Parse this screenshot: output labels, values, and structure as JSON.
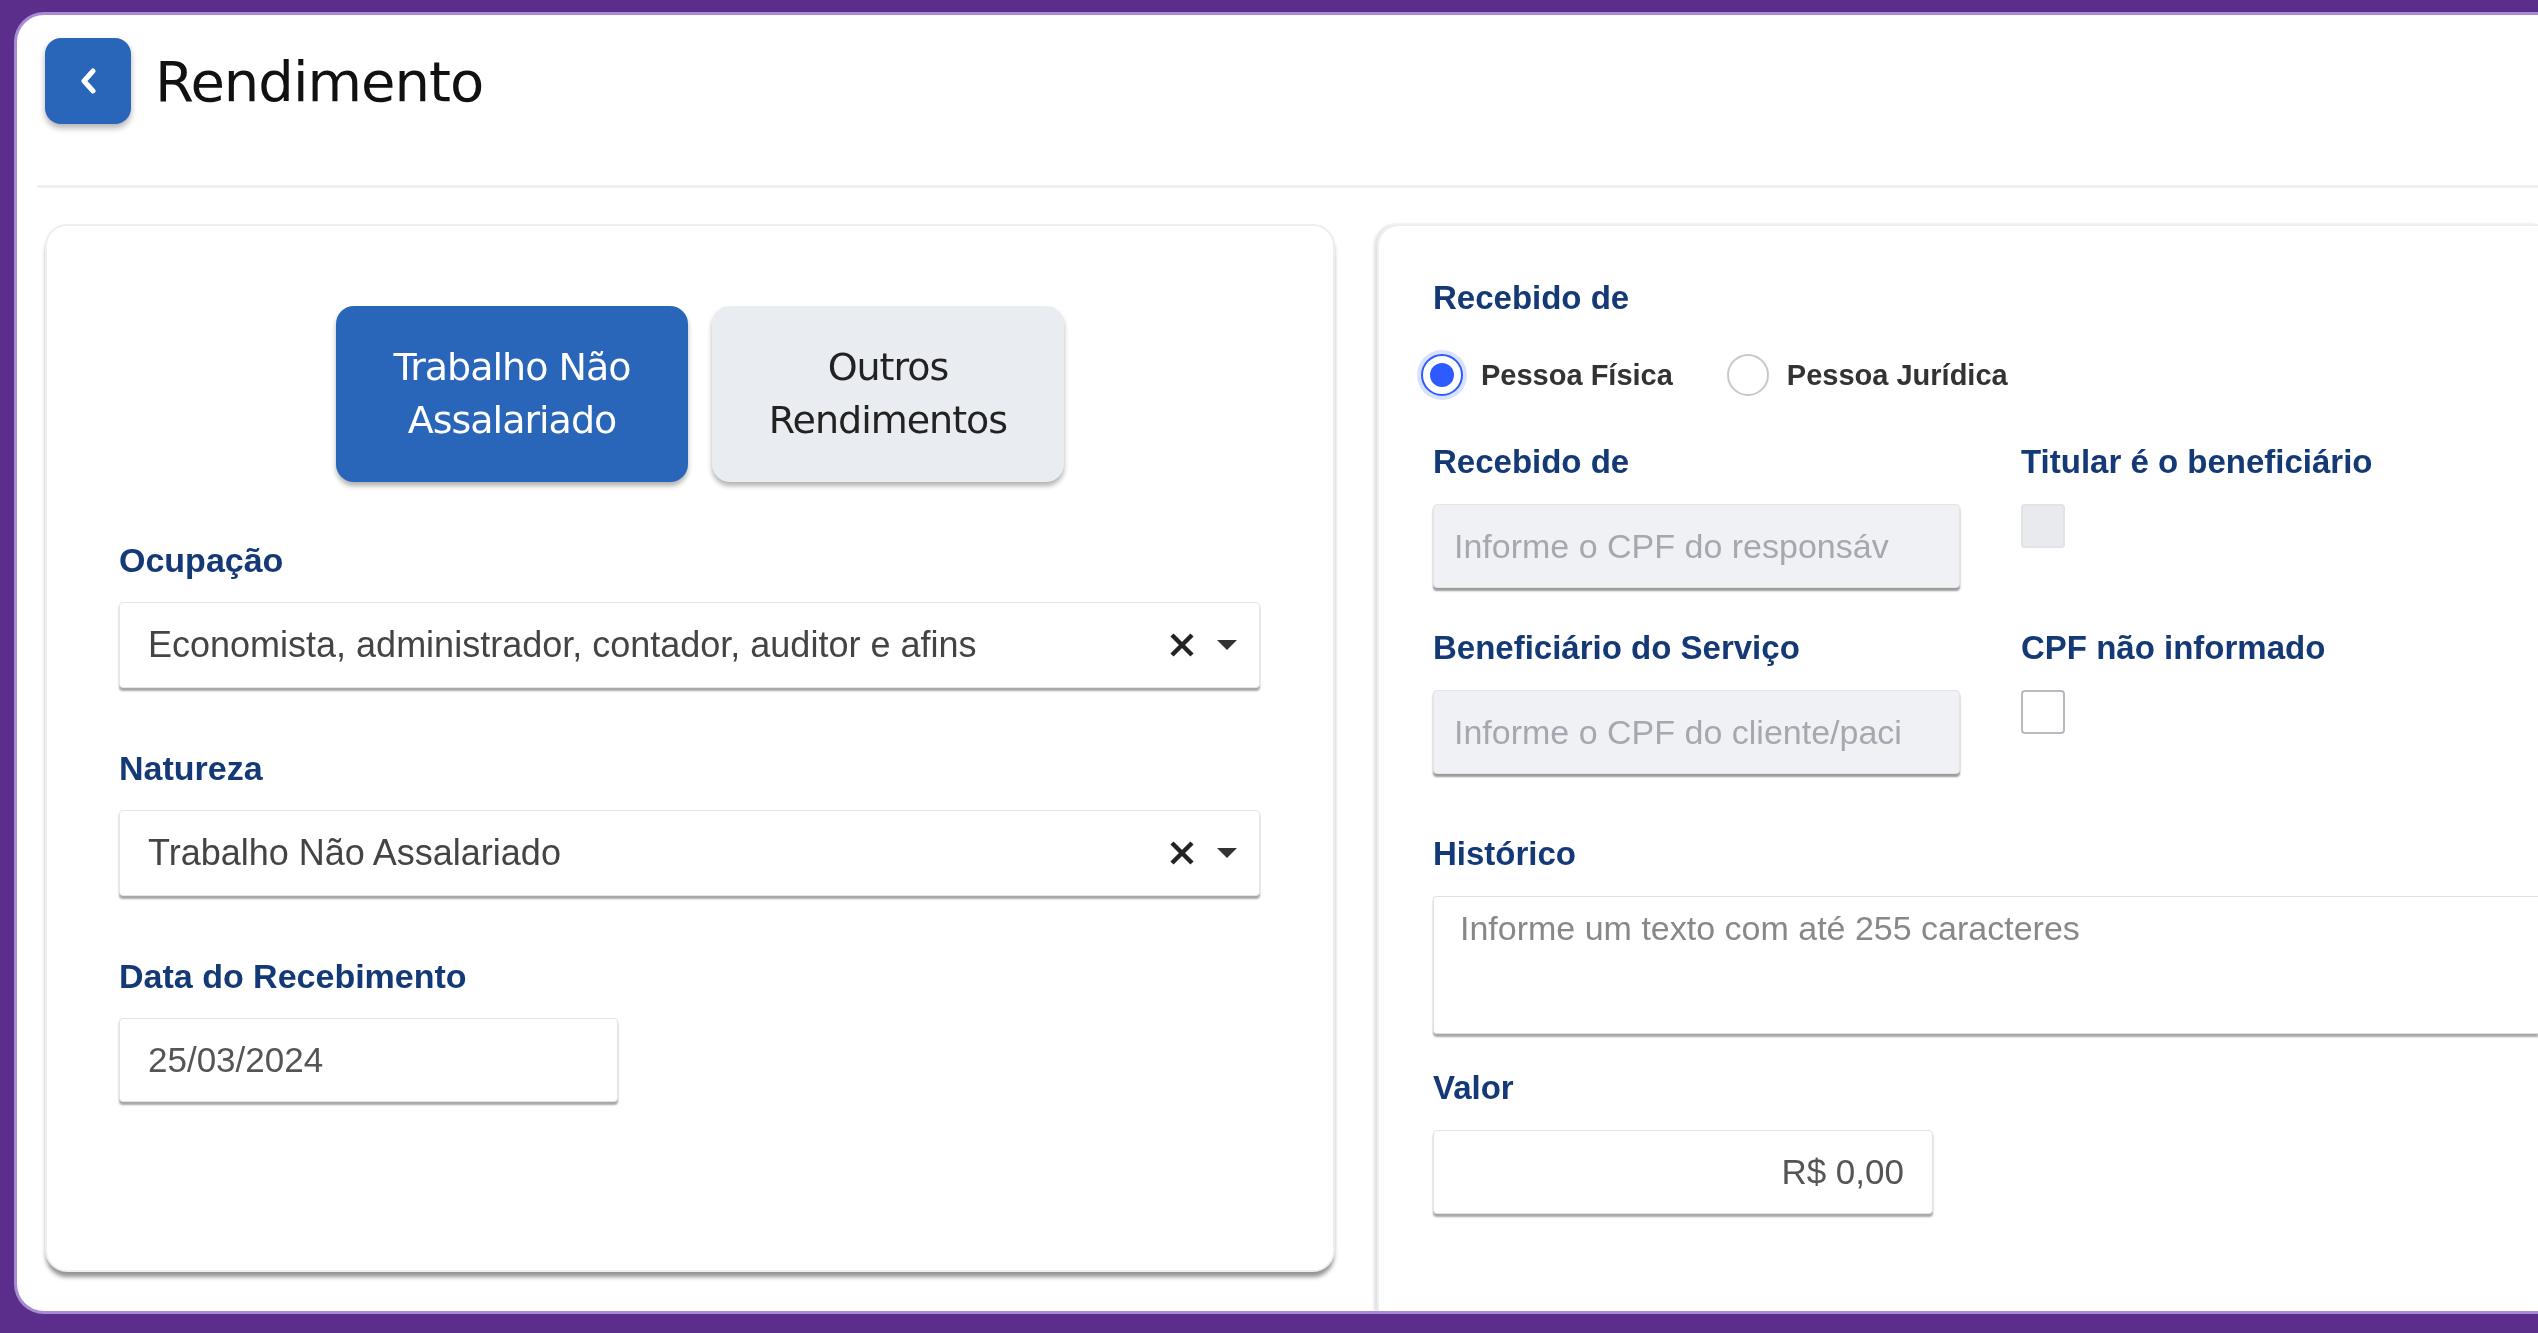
{
  "header": {
    "title": "Rendimento"
  },
  "tabs": [
    {
      "label": "Trabalho Não Assalariado",
      "selected": true
    },
    {
      "label": "Outros Rendimentos",
      "selected": false
    }
  ],
  "left_form": {
    "ocupacao": {
      "label": "Ocupação",
      "value": "Economista, administrador, contador, auditor e afins"
    },
    "natureza": {
      "label": "Natureza",
      "value": "Trabalho Não Assalariado"
    },
    "data": {
      "label": "Data do Recebimento",
      "value": "25/03/2024"
    }
  },
  "right_form": {
    "recebido_group_label": "Recebido de",
    "radios": [
      {
        "label": "Pessoa Física",
        "selected": true
      },
      {
        "label": "Pessoa Jurídica",
        "selected": false
      }
    ],
    "rows": [
      {
        "label": "Recebido de",
        "placeholder": "Informe o CPF do responsáv",
        "check_label": "Titular é o beneficiário",
        "checked": false,
        "disabled": true
      },
      {
        "label": "Beneficiário do Serviço",
        "placeholder": "Informe o CPF do cliente/paci",
        "check_label": "CPF não informado",
        "checked": false,
        "disabled": false
      }
    ],
    "historico": {
      "label": "Histórico",
      "placeholder": "Informe um texto com até 255 caracteres"
    },
    "valor": {
      "label": "Valor",
      "value": "R$ 0,00"
    }
  }
}
